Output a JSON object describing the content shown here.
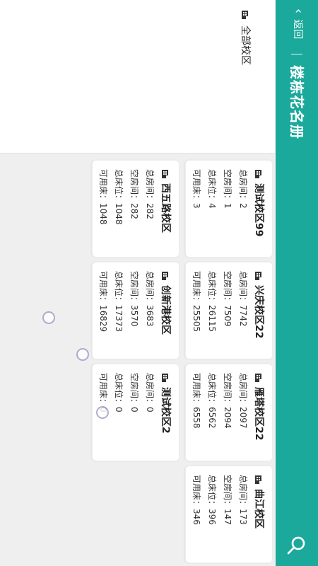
{
  "header": {
    "back_label": "返回",
    "title": "楼栋花名册",
    "search_icon": "search-icon"
  },
  "filter": {
    "selected_label": "全部校区"
  },
  "labels": {
    "total_rooms": "总房间：",
    "empty_rooms": "空房间：",
    "total_beds": "总床位：",
    "available_beds": "可用床："
  },
  "campuses": [
    {
      "name": "测试校区99",
      "total_rooms": "2",
      "empty_rooms": "1",
      "total_beds": "4",
      "available_beds": "3"
    },
    {
      "name": "兴庆校区22",
      "total_rooms": "7742",
      "empty_rooms": "7509",
      "total_beds": "26115",
      "available_beds": "25505"
    },
    {
      "name": "雁塔校区22",
      "total_rooms": "2097",
      "empty_rooms": "2094",
      "total_beds": "6562",
      "available_beds": "6558"
    },
    {
      "name": "曲江校区",
      "total_rooms": "173",
      "empty_rooms": "147",
      "total_beds": "396",
      "available_beds": "346"
    },
    {
      "name": "西五路校区",
      "total_rooms": "282",
      "empty_rooms": "282",
      "total_beds": "1048",
      "available_beds": "1048"
    },
    {
      "name": "创新港校区",
      "total_rooms": "3683",
      "empty_rooms": "3570",
      "total_beds": "17373",
      "available_beds": "16829"
    },
    {
      "name": "测试校区2",
      "total_rooms": "0",
      "empty_rooms": "0",
      "total_beds": "0",
      "available_beds": "0"
    }
  ],
  "colors": {
    "header": "#1aa99b",
    "background": "#efefef"
  }
}
